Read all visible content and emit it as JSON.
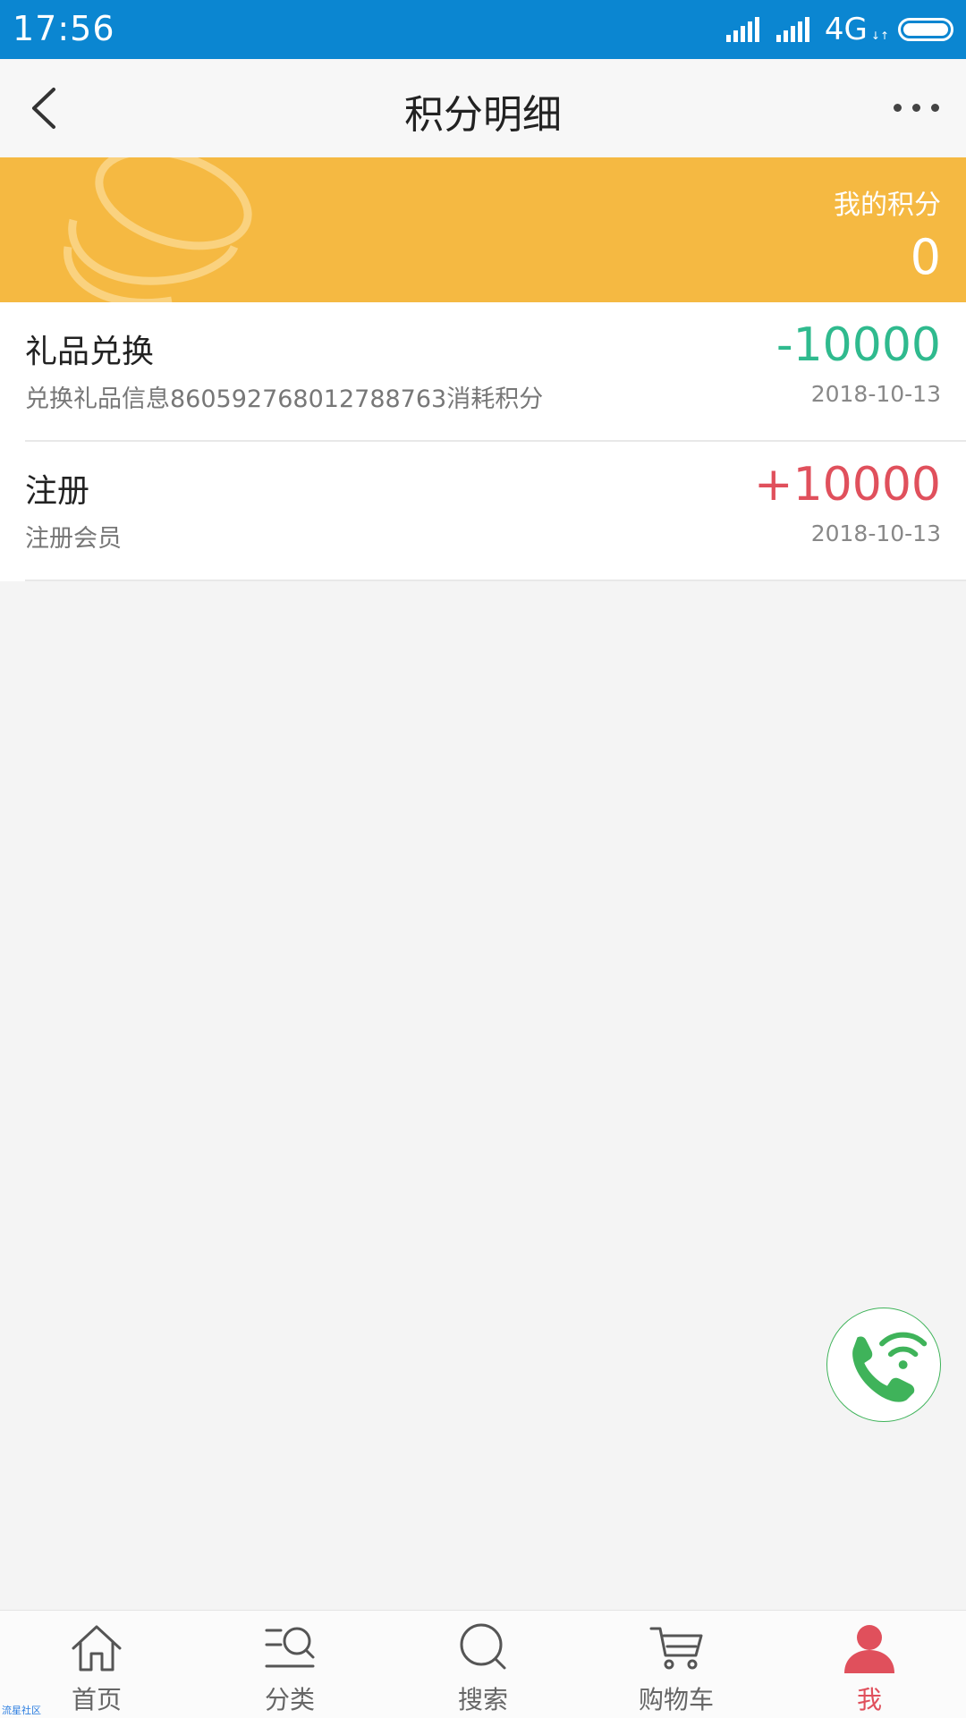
{
  "status_bar": {
    "time": "17:56",
    "network": "4G"
  },
  "header": {
    "title": "积分明细"
  },
  "points": {
    "label": "我的积分",
    "value": "0"
  },
  "records": [
    {
      "title": "礼品兑换",
      "desc": "兑换礼品信息860592768012788763消耗积分",
      "amount": "-10000",
      "date": "2018-10-13"
    },
    {
      "title": "注册",
      "desc": "注册会员",
      "amount": "+10000",
      "date": "2018-10-13"
    }
  ],
  "tabs": [
    {
      "label": "首页",
      "icon": "home-icon"
    },
    {
      "label": "分类",
      "icon": "category-icon"
    },
    {
      "label": "搜索",
      "icon": "search-icon"
    },
    {
      "label": "购物车",
      "icon": "cart-icon"
    },
    {
      "label": "我",
      "icon": "user-icon",
      "active": true
    }
  ],
  "watermark": "流星社区",
  "colors": {
    "status": "#0b86d1",
    "banner": "#f5b942",
    "negative": "#2fba8e",
    "positive": "#e0505c"
  }
}
